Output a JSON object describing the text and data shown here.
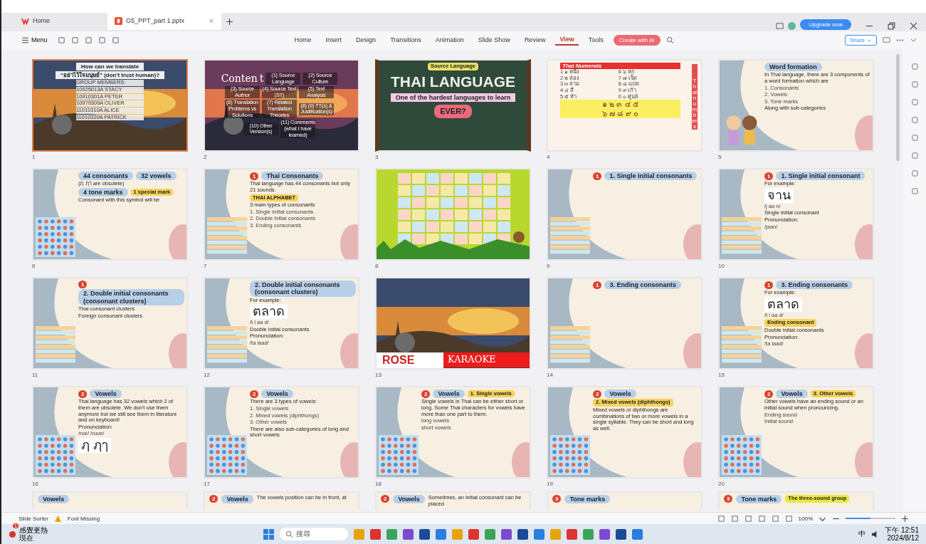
{
  "window_tabs": [
    {
      "label": "Home",
      "selected": false,
      "kind": "home"
    },
    {
      "label": "G5_PPT_part 1.pptx",
      "selected": true,
      "kind": "file"
    }
  ],
  "toolbar": {
    "menu": "Menu",
    "ribbon": [
      {
        "label": "Home",
        "selected": false
      },
      {
        "label": "Insert",
        "selected": false
      },
      {
        "label": "Design",
        "selected": false
      },
      {
        "label": "Transitions",
        "selected": false
      },
      {
        "label": "Animation",
        "selected": false
      },
      {
        "label": "Slide Show",
        "selected": false
      },
      {
        "label": "Review",
        "selected": false
      },
      {
        "label": "View",
        "selected": true
      },
      {
        "label": "Tools",
        "selected": false
      }
    ],
    "ai_button": "Create with AI",
    "upgrade": "Upgrade now",
    "share": "Share"
  },
  "slides": [
    {
      "number": "1",
      "selected": true,
      "texts": [
        {
          "kind": "title",
          "text": "How can we translate"
        },
        {
          "kind": "title",
          "text": "“อย่าไว้ใจมนุษย์” (don't trust human)?"
        },
        {
          "kind": "item",
          "text": "GROUP MEMBERS:"
        },
        {
          "kind": "item",
          "text": "10925013A  STACY"
        },
        {
          "kind": "item",
          "text": "10910301A  PETER"
        },
        {
          "kind": "item",
          "text": "10979309A  OLIVER"
        },
        {
          "kind": "item",
          "text": "11010310A  ALICE"
        },
        {
          "kind": "item",
          "text": "11010320A  PATRICK"
        }
      ]
    },
    {
      "number": "2",
      "selected": false,
      "kind": "menu",
      "texts": [
        {
          "kind": "title",
          "text": "Conten"
        },
        {
          "kind": "title",
          "text": "t"
        },
        {
          "kind": "item",
          "text": "(1) Source Language"
        },
        {
          "kind": "item",
          "text": "(2) Source Culture"
        },
        {
          "kind": "item",
          "text": "(3) Source Author"
        },
        {
          "kind": "item",
          "text": "(4) Source Text (ST)"
        },
        {
          "kind": "item",
          "text": "(5) Text Analysis"
        },
        {
          "kind": "item",
          "text": "(6) Translation Problems vs Solutions"
        },
        {
          "kind": "item",
          "text": "(7) Related Translation Theories"
        },
        {
          "kind": "item",
          "text": "(8) (9) TT(s) & Justification(s)"
        },
        {
          "kind": "item",
          "text": "(10) Other Version(s)"
        },
        {
          "kind": "item",
          "text": "(11) Comments (what I have learned)"
        }
      ]
    },
    {
      "number": "3",
      "selected": false,
      "kind": "chalk",
      "texts": [
        {
          "kind": "tag",
          "text": "Source Language"
        },
        {
          "kind": "big",
          "text": "THAI LANGUAGE"
        },
        {
          "kind": "title",
          "text": "One of the hardest languages to learn"
        },
        {
          "kind": "badge",
          "text": "EVER?"
        }
      ]
    },
    {
      "number": "4",
      "selected": false,
      "kind": "numerals",
      "texts": [
        {
          "kind": "title",
          "text": "Thai Numerals"
        },
        {
          "kind": "item",
          "text": "1 ๑ หนึ่ง"
        },
        {
          "kind": "item",
          "text": "6 ๖ หก"
        },
        {
          "kind": "item",
          "text": "2 ๒ สอง"
        },
        {
          "kind": "item",
          "text": "7 ๗ เจ็ด"
        },
        {
          "kind": "item",
          "text": "3 ๓ สาม"
        },
        {
          "kind": "item",
          "text": "8 ๘ แปด"
        },
        {
          "kind": "item",
          "text": "4 ๔ สี่"
        },
        {
          "kind": "item",
          "text": "9 ๙ เก้า"
        },
        {
          "kind": "item",
          "text": "5 ๕ ห้า"
        },
        {
          "kind": "item",
          "text": "0 ๐ ศูนย์"
        },
        {
          "kind": "big",
          "text": "๑ ๒ ๓ ๔ ๕"
        },
        {
          "kind": "big",
          "text": "๖ ๗ ๘ ๙ ๐"
        },
        {
          "kind": "side",
          "text": "Thai numbers"
        }
      ]
    },
    {
      "number": "5",
      "selected": false,
      "kind": "cartoon",
      "texts": [
        {
          "kind": "title",
          "text": "Word formation"
        },
        {
          "kind": "text",
          "text": "In Thai language, there are 3 components of a word formation which are"
        },
        {
          "kind": "item",
          "text": "1. Consonants"
        },
        {
          "kind": "item",
          "text": "2. Vowels"
        },
        {
          "kind": "item",
          "text": "3. Tone marks"
        },
        {
          "kind": "text",
          "text": "Along with sub-categories"
        }
      ]
    },
    {
      "number": "6",
      "selected": false,
      "kind": "grid",
      "texts": [
        {
          "kind": "title",
          "text": "44 consonants"
        },
        {
          "kind": "title",
          "text": "32 vowels"
        },
        {
          "kind": "text",
          "text": "(ฦ ฦๅ are obsolete)"
        },
        {
          "kind": "title",
          "text": "4 tone marks"
        },
        {
          "kind": "tag",
          "text": "1 special mark"
        },
        {
          "kind": "text",
          "text": "Consonant with this symbol will be"
        }
      ]
    },
    {
      "number": "7",
      "selected": false,
      "kind": "table",
      "texts": [
        {
          "kind": "badge",
          "text": "1"
        },
        {
          "kind": "title",
          "text": "Thai Consonants"
        },
        {
          "kind": "text",
          "text": "Thai language has 44 consonants but only 21 sounds."
        },
        {
          "kind": "tag",
          "text": "THAI ALPHABET"
        },
        {
          "kind": "text",
          "text": "3 main types of consonants"
        },
        {
          "kind": "item",
          "text": "1. Single Initial consonants"
        },
        {
          "kind": "item",
          "text": "2. Double Initial consonants"
        },
        {
          "kind": "item",
          "text": "3. Ending consonants"
        }
      ]
    },
    {
      "number": "8",
      "selected": false,
      "kind": "poster"
    },
    {
      "number": "9",
      "selected": false,
      "kind": "table",
      "texts": [
        {
          "kind": "badge",
          "text": "1"
        },
        {
          "kind": "title",
          "text": "1. Single Initial consonants"
        }
      ]
    },
    {
      "number": "10",
      "selected": false,
      "kind": "table",
      "texts": [
        {
          "kind": "badge",
          "text": "1"
        },
        {
          "kind": "title",
          "text": "1. Single initial consonant"
        },
        {
          "kind": "text",
          "text": "For example:"
        },
        {
          "kind": "big",
          "text": "จาน"
        },
        {
          "kind": "item",
          "text": "/j  aa  n/"
        },
        {
          "kind": "text",
          "text": "Single initial consonant"
        },
        {
          "kind": "text",
          "text": "Pronunciation:"
        },
        {
          "kind": "item",
          "text": "/jaan/"
        }
      ]
    },
    {
      "number": "11",
      "selected": false,
      "kind": "table",
      "texts": [
        {
          "kind": "badge",
          "text": "1"
        },
        {
          "kind": "title",
          "text": "2. Double initial consonants (consonant clusters)"
        },
        {
          "kind": "text",
          "text": "Thai consonant clusters"
        },
        {
          "kind": "text",
          "text": "Foreign consonant clusters"
        }
      ]
    },
    {
      "number": "12",
      "selected": false,
      "kind": "table",
      "texts": [
        {
          "kind": "title",
          "text": "2. Double initial consonants (consonant clusters)"
        },
        {
          "kind": "text",
          "text": "For example:"
        },
        {
          "kind": "big",
          "text": "ตลาด"
        },
        {
          "kind": "item",
          "text": "/t l  aa  d/"
        },
        {
          "kind": "text",
          "text": "Double initial consonants"
        },
        {
          "kind": "text",
          "text": "Pronunciation:"
        },
        {
          "kind": "item",
          "text": "/ta laad/"
        }
      ]
    },
    {
      "number": "13",
      "selected": false,
      "kind": "karaoke",
      "texts": [
        {
          "kind": "title",
          "text": "ROSE"
        },
        {
          "kind": "big",
          "text": "KARAOKE"
        }
      ]
    },
    {
      "number": "14",
      "selected": false,
      "kind": "table",
      "texts": [
        {
          "kind": "badge",
          "text": "1"
        },
        {
          "kind": "title",
          "text": "3. Ending consonants"
        }
      ]
    },
    {
      "number": "15",
      "selected": false,
      "kind": "table",
      "texts": [
        {
          "kind": "badge",
          "text": "1"
        },
        {
          "kind": "title",
          "text": "3. Ending consonants"
        },
        {
          "kind": "text",
          "text": "For example:"
        },
        {
          "kind": "big",
          "text": "ตลาด"
        },
        {
          "kind": "item",
          "text": "/t l  aa  d/"
        },
        {
          "kind": "tag",
          "text": "Ending consonant"
        },
        {
          "kind": "text",
          "text": "Double initial consonants"
        },
        {
          "kind": "text",
          "text": "Pronunciation:"
        },
        {
          "kind": "item",
          "text": "/ta laad/"
        }
      ]
    },
    {
      "number": "16",
      "selected": false,
      "kind": "grid",
      "texts": [
        {
          "kind": "badge",
          "text": "2"
        },
        {
          "kind": "title",
          "text": "Vowels"
        },
        {
          "kind": "text",
          "text": "Thai language has 32 vowels which 2 of them are obsolete. We don't use them anymore but we still see them in literature and on keyboard!"
        },
        {
          "kind": "text",
          "text": "Pronunciation:"
        },
        {
          "kind": "item",
          "text": "/rue/   /ruue/"
        },
        {
          "kind": "big",
          "text": "ฦ ฦๅ"
        }
      ]
    },
    {
      "number": "17",
      "selected": false,
      "kind": "grid",
      "texts": [
        {
          "kind": "badge",
          "text": "2"
        },
        {
          "kind": "title",
          "text": "Vowels"
        },
        {
          "kind": "text",
          "text": "There are 3 types of vowels:"
        },
        {
          "kind": "item",
          "text": "1. Single vowels"
        },
        {
          "kind": "item",
          "text": "2. Mixed vowels (diphthongs)"
        },
        {
          "kind": "item",
          "text": "3. Other vowels"
        },
        {
          "kind": "text",
          "text": "There are also sub-categories of long and short vowels"
        }
      ]
    },
    {
      "number": "18",
      "selected": false,
      "kind": "grid",
      "texts": [
        {
          "kind": "badge",
          "text": "2"
        },
        {
          "kind": "title",
          "text": "Vowels"
        },
        {
          "kind": "tag",
          "text": "1. Single vowels"
        },
        {
          "kind": "text",
          "text": "Single vowels in Thai can be either short or long. Some Thai characters for vowels have more than one part to them."
        },
        {
          "kind": "item",
          "text": "long vowels"
        },
        {
          "kind": "item",
          "text": "short vowels"
        }
      ]
    },
    {
      "number": "19",
      "selected": false,
      "kind": "grid",
      "texts": [
        {
          "kind": "badge",
          "text": "2"
        },
        {
          "kind": "title",
          "text": "Vowels"
        },
        {
          "kind": "tag",
          "text": "2. Mixed vowels (diphthongs)"
        },
        {
          "kind": "text",
          "text": "Mixed vowels or diphthongs are combinations of two or more vowels in a single syllable. They can be short and long as well."
        }
      ]
    },
    {
      "number": "20",
      "selected": false,
      "kind": "grid",
      "texts": [
        {
          "kind": "badge",
          "text": "2"
        },
        {
          "kind": "title",
          "text": "Vowels"
        },
        {
          "kind": "tag",
          "text": "3. Other vowels"
        },
        {
          "kind": "text",
          "text": "Other vowels have an ending sound or an initial sound when pronouncing."
        },
        {
          "kind": "item",
          "text": "Ending sound"
        },
        {
          "kind": "item",
          "text": "Initial sound"
        }
      ]
    },
    {
      "selected": false,
      "kind": "plain",
      "texts": [
        {
          "kind": "title",
          "text": "Vowels"
        }
      ]
    },
    {
      "selected": false,
      "kind": "plain",
      "texts": [
        {
          "kind": "badge",
          "text": "2"
        },
        {
          "kind": "title",
          "text": "Vowels"
        },
        {
          "kind": "text",
          "text": "The vowels position can be in front, at"
        }
      ]
    },
    {
      "selected": false,
      "kind": "plain",
      "texts": [
        {
          "kind": "badge",
          "text": "2"
        },
        {
          "kind": "title",
          "text": "Vowels"
        },
        {
          "kind": "text",
          "text": "Sometimes, an initial consonant can be placed"
        }
      ]
    },
    {
      "selected": false,
      "kind": "plain",
      "texts": [
        {
          "kind": "badge",
          "text": "3"
        },
        {
          "kind": "title",
          "text": "Tone marks"
        }
      ]
    },
    {
      "selected": false,
      "kind": "plain",
      "texts": [
        {
          "kind": "badge",
          "text": "3"
        },
        {
          "kind": "title",
          "text": "Tone marks"
        },
        {
          "kind": "tag",
          "text": "The three-sound group"
        }
      ]
    }
  ],
  "status_bar": {
    "view": "Slide Sorter",
    "warning": "Font Missing",
    "zoom": "100%",
    "zoom_slider": {
      "level": 0.5
    }
  },
  "taskbar": {
    "weather": "感覺更熱",
    "weather_sub": "現在",
    "badge": "1",
    "search": "搜尋",
    "ime": "中",
    "time": "下午 12:51",
    "date": "2024/8/12"
  }
}
